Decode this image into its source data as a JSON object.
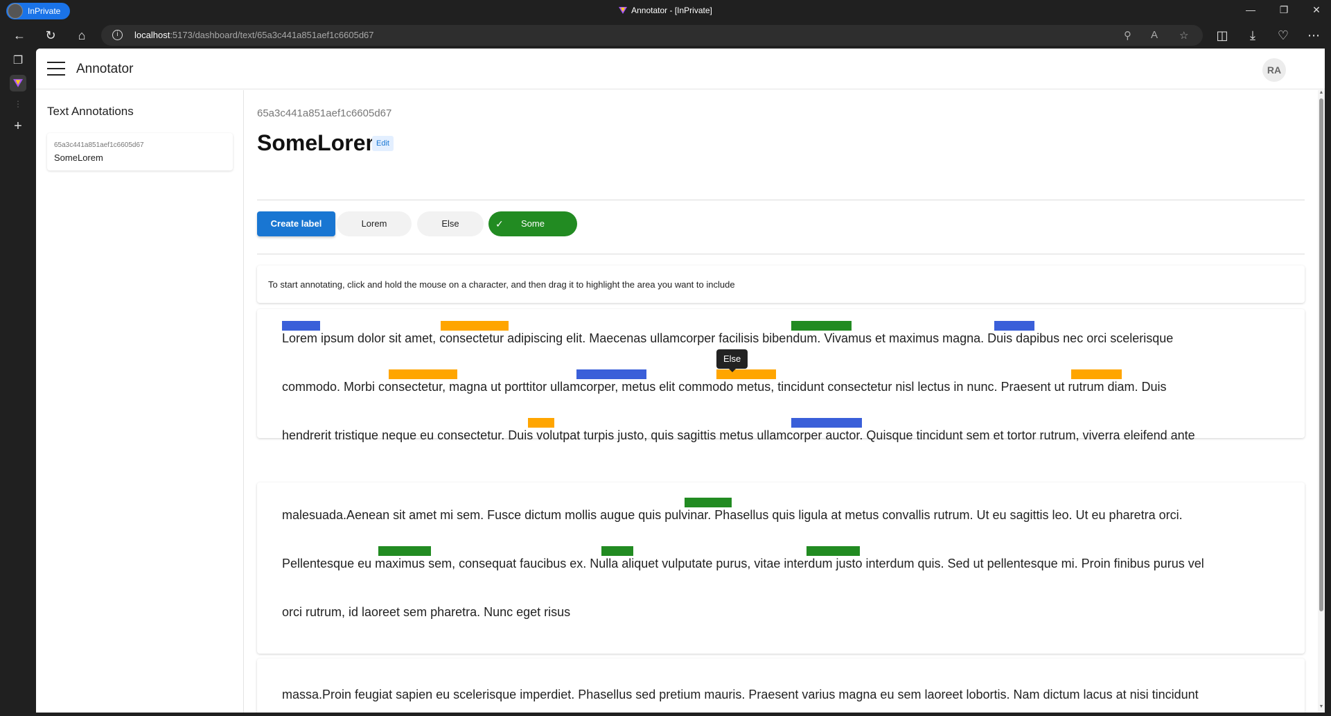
{
  "browser": {
    "inprivate_label": "InPrivate",
    "window_title": "Annotator - [InPrivate]",
    "url_host": "localhost",
    "url_rest": ":5173/dashboard/text/65a3c441a851aef1c6605d67"
  },
  "app": {
    "title": "Annotator",
    "user_initials": "RA"
  },
  "sidebar": {
    "heading": "Text Annotations",
    "items": [
      {
        "id": "65a3c441a851aef1c6605d67",
        "name": "SomeLorem"
      }
    ]
  },
  "document": {
    "id": "65a3c441a851aef1c6605d67",
    "title": "SomeLorem",
    "edit_label": "Edit"
  },
  "labels": {
    "create_label": "Create label",
    "items": [
      {
        "name": "Lorem",
        "color": "#3a5fd9",
        "selected": false
      },
      {
        "name": "Else",
        "color": "#ffa500",
        "selected": false
      },
      {
        "name": "Some",
        "color": "#228b22",
        "selected": true
      }
    ]
  },
  "hint": "To start annotating, click and hold the mouse on a character, and then drag it to highlight the area you want to include",
  "tooltip": "Else",
  "paragraphs": [
    {
      "lines": [
        "Lorem ipsum dolor sit amet, consectetur adipiscing elit. Maecenas ullamcorper facilisis bibendum. Vivamus et maximus magna. Duis dapibus nec orci scelerisque",
        "commodo. Morbi consectetur, magna ut porttitor ullamcorper, metus elit commodo metus, tincidunt consectetur nisl lectus in nunc. Praesent ut rutrum diam. Duis",
        "hendrerit tristique neque eu consectetur. Duis volutpat turpis justo, quis sagittis metus ullamcorper auctor. Quisque tincidunt sem et tortor rutrum, viverra eleifend ante"
      ]
    },
    {
      "lines": [
        "malesuada.Aenean sit amet mi sem. Fusce dictum mollis augue quis pulvinar. Phasellus quis ligula at metus convallis rutrum. Ut eu sagittis leo. Ut eu pharetra orci.",
        "Pellentesque eu maximus sem, consequat faucibus ex. Nulla aliquet vulputate purus, vitae interdum justo interdum quis. Sed ut pellentesque mi. Proin finibus purus vel",
        "orci rutrum, id laoreet sem pharetra. Nunc eget risus"
      ]
    },
    {
      "lines": [
        "massa.Proin feugiat sapien eu scelerisque imperdiet. Phasellus sed pretium mauris. Praesent varius magna eu sem laoreet lobortis. Nam dictum lacus at nisi tincidunt"
      ]
    }
  ]
}
